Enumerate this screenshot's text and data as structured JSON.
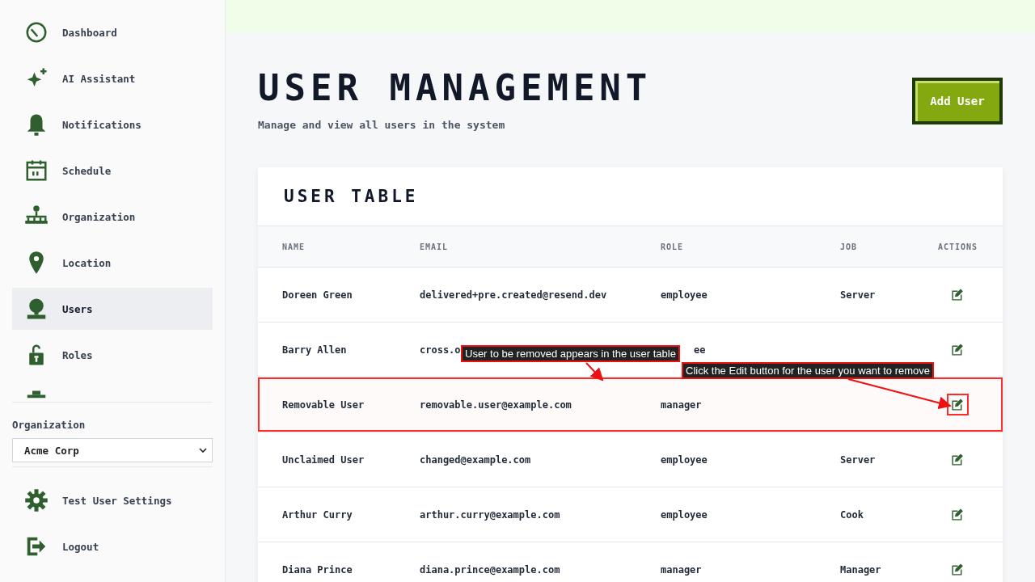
{
  "sidebar": {
    "items": [
      {
        "label": "Dashboard",
        "selected": false
      },
      {
        "label": "AI Assistant",
        "selected": false
      },
      {
        "label": "Notifications",
        "selected": false
      },
      {
        "label": "Schedule",
        "selected": false
      },
      {
        "label": "Organization",
        "selected": false
      },
      {
        "label": "Location",
        "selected": false
      },
      {
        "label": "Users",
        "selected": true
      },
      {
        "label": "Roles",
        "selected": false
      }
    ],
    "org_label": "Organization",
    "org_select": "Acme Corp",
    "footer_items": [
      {
        "label": "Test User Settings"
      },
      {
        "label": "Logout"
      }
    ]
  },
  "page": {
    "title": "USER MANAGEMENT",
    "subtitle": "Manage and view all users in the system",
    "add_button": "Add User"
  },
  "table": {
    "title": "USER TABLE",
    "columns": [
      "NAME",
      "EMAIL",
      "ROLE",
      "JOB",
      "ACTIONS"
    ],
    "rows": [
      {
        "name": "Doreen Green",
        "email": "delivered+pre.created@resend.dev",
        "role": "employee",
        "job": "Server",
        "highlighted": false
      },
      {
        "name": "Barry Allen",
        "email": "cross.o",
        "role": "ee",
        "job": "",
        "highlighted": false
      },
      {
        "name": "Removable User",
        "email": "removable.user@example.com",
        "role": "manager",
        "job": "",
        "highlighted": true
      },
      {
        "name": "Unclaimed User",
        "email": "changed@example.com",
        "role": "employee",
        "job": "Server",
        "highlighted": false
      },
      {
        "name": "Arthur Curry",
        "email": "arthur.curry@example.com",
        "role": "employee",
        "job": "Cook",
        "highlighted": false
      },
      {
        "name": "Diana Prince",
        "email": "diana.prince@example.com",
        "role": "manager",
        "job": "Manager",
        "highlighted": false
      }
    ]
  },
  "annotations": [
    "User to be removed appears in the user table",
    "Click the Edit button for the user you want to remove"
  ]
}
